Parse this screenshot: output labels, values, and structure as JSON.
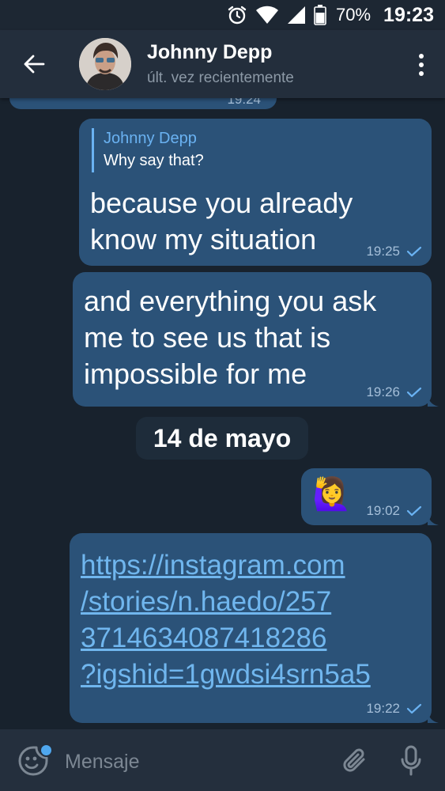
{
  "status_bar": {
    "battery_percent": "70%",
    "time": "19:23",
    "icons": [
      "alarm-icon",
      "wifi-icon",
      "signal-icon",
      "battery-icon"
    ]
  },
  "header": {
    "name": "Johnny Depp",
    "status": "últ. vez recientemente",
    "icons": [
      "back-arrow-icon",
      "more-vertical-icon"
    ]
  },
  "chat": {
    "previous_time": "19:24",
    "messages": [
      {
        "reply_to_name": "Johnny Depp",
        "reply_to_text": "Why say that?",
        "text_line1": "because you already",
        "text_line2": "know my situation",
        "time": "19:25"
      },
      {
        "text_line1": "and everything you ask",
        "text_line2": "me to see us that is",
        "text_line3": "impossible for me",
        "time": "19:26"
      }
    ],
    "date_separator": "14 de mayo",
    "emoji_message": {
      "emoji": "🙋‍♀️",
      "time": "19:02"
    },
    "link_message": {
      "line1": "https://instagram.com",
      "line2": "/stories/n.haedo/257",
      "line3": "3714634087418286",
      "line4": "?igshid=1gwdsi4srn5a5",
      "time": "19:22"
    }
  },
  "input_bar": {
    "placeholder": "Mensaje",
    "icons": [
      "sticker-emoji-icon",
      "paperclip-icon",
      "microphone-icon"
    ]
  },
  "colors": {
    "background": "#18222d",
    "header": "#232e3c",
    "bubble_out": "#2b5278",
    "accent": "#6ab2f2",
    "link": "#70b6ee",
    "time_text": "#a5bfd9"
  }
}
